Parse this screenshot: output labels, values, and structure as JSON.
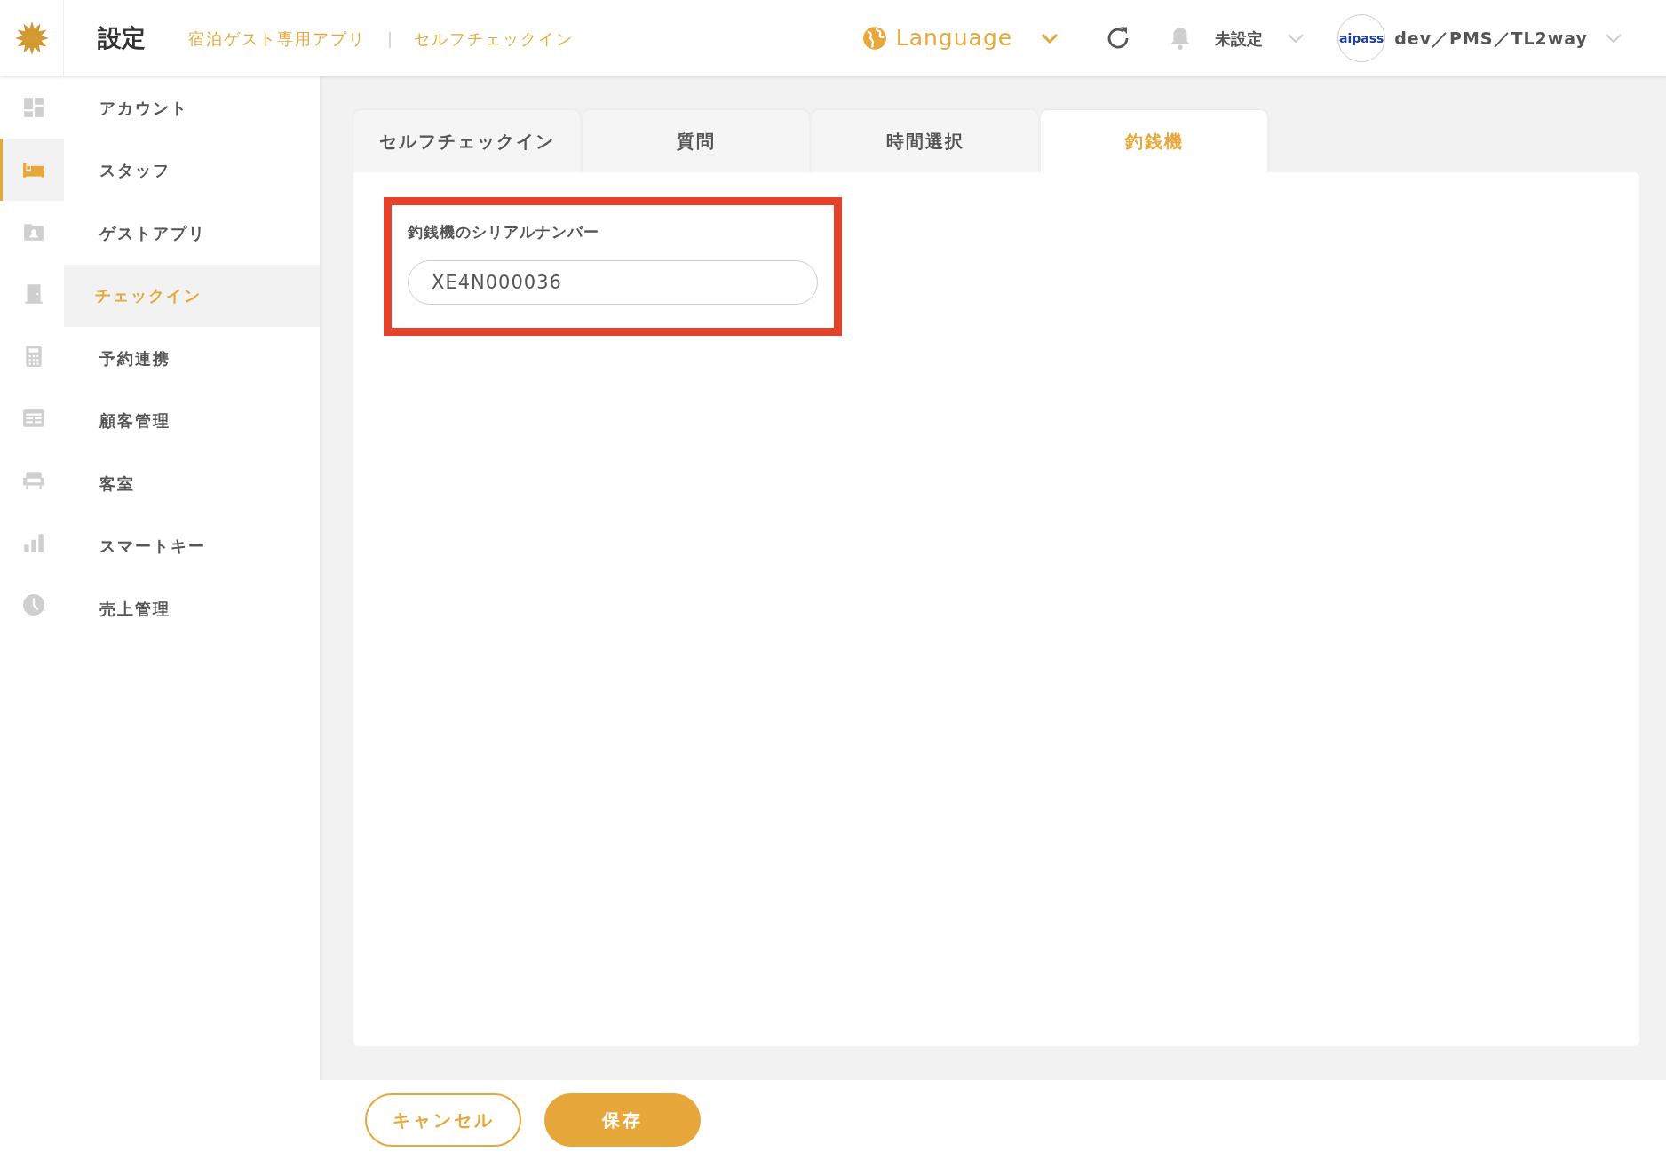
{
  "header": {
    "title": "設定",
    "breadcrumbs": [
      "宿泊ゲスト専用アプリ",
      "セルフチェックイン"
    ],
    "separator": "|",
    "language": "Language",
    "status": "未設定",
    "logo_text": "aipass",
    "account": "dev／PMS／TL2way"
  },
  "icon_rail": [
    {
      "kind": "dashboard",
      "selected": false
    },
    {
      "kind": "bed",
      "selected": true
    },
    {
      "kind": "folder",
      "selected": false
    },
    {
      "kind": "door",
      "selected": false
    },
    {
      "kind": "calculator",
      "selected": false
    },
    {
      "kind": "list",
      "selected": false
    },
    {
      "kind": "sofa",
      "selected": false
    },
    {
      "kind": "chart",
      "selected": false
    },
    {
      "kind": "clock",
      "selected": false
    }
  ],
  "sidebar": {
    "items": [
      {
        "label": "アカウント",
        "selected": false
      },
      {
        "label": "スタッフ",
        "selected": false
      },
      {
        "label": "ゲストアプリ",
        "selected": false
      },
      {
        "label": "チェックイン",
        "selected": true
      },
      {
        "label": "予約連携",
        "selected": false
      },
      {
        "label": "顧客管理",
        "selected": false
      },
      {
        "label": "客室",
        "selected": false
      },
      {
        "label": "スマートキー",
        "selected": false
      },
      {
        "label": "売上管理",
        "selected": false
      }
    ]
  },
  "tabs": [
    {
      "label": "セルフチェックイン",
      "selected": false
    },
    {
      "label": "質問",
      "selected": false
    },
    {
      "label": "時間選択",
      "selected": false
    },
    {
      "label": "釣銭機",
      "selected": true
    }
  ],
  "form": {
    "label": "釣銭機のシリアルナンバー",
    "value": "XE4N000036",
    "highlighted": true
  },
  "buttons": [
    {
      "label": "キャンセル",
      "kind": "secondary"
    },
    {
      "label": "保存",
      "kind": "primary"
    }
  ]
}
